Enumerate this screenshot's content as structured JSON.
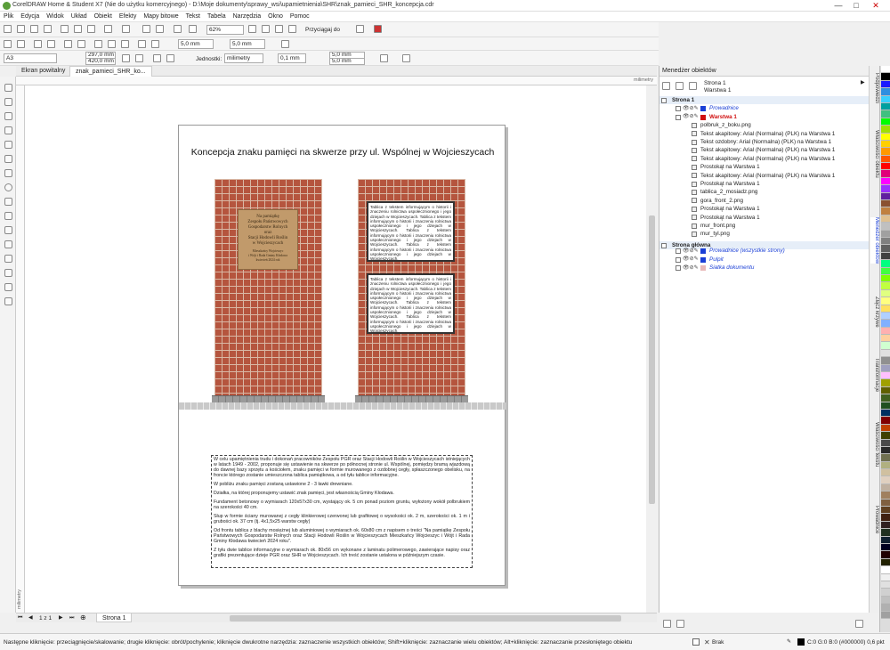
{
  "window": {
    "title": "CorelDRAW Home & Student X7 (Nie do użytku komercyjnego) - D:\\Moje dokumenty\\sprawy_wsi\\upamietnienia\\SHR\\znak_pamieci_SHR_koncepcja.cdr"
  },
  "menu": [
    "Plik",
    "Edycja",
    "Widok",
    "Układ",
    "Obiekt",
    "Efekty",
    "Mapy bitowe",
    "Tekst",
    "Tabela",
    "Narzędzia",
    "Okno",
    "Pomoc"
  ],
  "toolbar": {
    "zoom": "62%",
    "snap_label": "Przyciągaj do",
    "nudge_h": "5,0 mm",
    "nudge_v": "5,0 mm"
  },
  "property_bar": {
    "page_size": "A3",
    "width": "297,0 mm",
    "height": "420,0 mm",
    "units_label": "Jednostki:",
    "units": "milimetry",
    "nudge": "0,1 mm",
    "dup_x": "5,0 mm",
    "dup_y": "5,0 mm"
  },
  "tabs": {
    "welcome": "Ekran powitalny",
    "document": "znak_pamieci_SHR_ko..."
  },
  "rulers": {
    "h_unit": "milimetry",
    "v_unit": "milimetry"
  },
  "page_bar": {
    "counter": "1 z 1",
    "page_tab": "Strona 1"
  },
  "document": {
    "title": "Koncepcja znaku pamięci na skwerze przy ul. Wspólnej w Wojcieszycach",
    "plaque": [
      "Na pamiątkę",
      "Zespołu Państwowych",
      "Gospodarstw Rolnych",
      "oraz",
      "Stacji Hodowli Roślin",
      "w Wojcieszycach",
      "Mieszkańcy Wojcieszyc",
      "i Wójt i Rada Gminy Kłodawa",
      "kwiecień 2024 rok"
    ],
    "panel_text": "Tablica z tekstem informującym o historii i znaczeniu rolnictwa uspołecznionego i jego dziejach w Wojcieszycach. Tablica z tekstem informującym o historii i znaczeniu rolnictwa uspołecznionego i jego dziejach w Wojcieszycach. Tablica z tekstem informującym o historii i znaczeniu rolnictwa uspołecznionego i jego dziejach w Wojcieszycach. Tablica z tekstem informującym o historii i znaczeniu rolnictwa uspołecznionego i jego dziejach w Wojcieszycach.",
    "paragraphs": [
      "W celu upamiętnienia trudu i dokonań pracowników Zespołu PGR oraz Stacji Hodowli Roślin w Wojcieszycach istniejących w latach 1949 - 2002, proponuje się ustawienie na skwerze po północnej stronie ul. Wspólnej, pomiędzy bramą wjazdową do dawnej bazy sprzętu a kościołem, znaku pamięci w formie murowanego z ozdobnej cegły, spłaszczonego obelisku, na froncie którego zostanie umieszczona tablica pamiątkowa, a od tyłu tablice informacyjne.",
      "W pobliżu znaku pamięci zostaną ustawione 2 - 3 ławki drewniane.",
      "Działka, na której proponujemy ustawić znak pamięci, jest własnością Gminy Kłodawa.",
      "Fundament betonowy o wymiarach 120x57x30 cm, wystający ok. 5 cm ponad poziom gruntu, wyłożony wokół polbrukiem na szerokości 40 cm.",
      "Słup w formie ściany murowanej z cegły klinkierowej czerwonej lub grafitowej o wysokości ok. 2 m, szerokości ok. 1 m i grubości ok. 37 cm (tj. 4x1,5x25 warstw cegły)",
      "Od frontu tablica z blachy mosiężnej lub aluminiowej o wymiarach ok. 60x80 cm z napisem o treści \"Na pamiątkę Zespołu Państwowych Gospodarstw Rolnych oraz Stacji Hodowli Roślin w Wojcieszycach Mieszkańcy Wojcieszyc i Wójt i Rada Gminy Kłodawa kwiecień 2024 roku\".",
      "Z tyłu dwie tablice informacyjne o wymiarach ok. 80x56 cm wykonane z laminatu polimerowego, zawierające napisy oraz grafiki prezentujące dzieje PGR oraz SHR w Wojcieszycach. Ich treść zostanie ustalona w późniejszym czasie."
    ]
  },
  "object_manager": {
    "header": "Menedżer obiektów",
    "breadcrumb": [
      "Strona 1",
      "Warstwa 1"
    ],
    "rows": [
      {
        "text": "Strona 1",
        "level": 0,
        "bold": true,
        "type": "page"
      },
      {
        "text": "Prowadnice",
        "level": 1,
        "italic": true,
        "color": "#1a3fd6",
        "swatch": "#1a3fd6",
        "type": "layer"
      },
      {
        "text": "Warstwa 1",
        "level": 1,
        "bold": true,
        "color": "#d01010",
        "swatch": "#d01010",
        "type": "layer"
      },
      {
        "text": "polbruk_z_boku.png",
        "level": 2,
        "type": "bitmap"
      },
      {
        "text": "Tekst akapitowy: Arial (Normalna) (PLK) na Warstwa 1",
        "level": 2,
        "type": "text"
      },
      {
        "text": "Tekst ozdobny: Arial (Normalna) (PLK) na Warstwa 1",
        "level": 2,
        "type": "artistic"
      },
      {
        "text": "Tekst akapitowy: Arial (Normalna) (PLK) na Warstwa 1",
        "level": 2,
        "type": "text"
      },
      {
        "text": "Tekst akapitowy: Arial (Normalna) (PLK) na Warstwa 1",
        "level": 2,
        "type": "text"
      },
      {
        "text": "Prostokąt na Warstwa 1",
        "level": 2,
        "type": "rect"
      },
      {
        "text": "Tekst akapitowy: Arial (Normalna) (PLK) na Warstwa 1",
        "level": 2,
        "type": "text"
      },
      {
        "text": "Prostokąt na Warstwa 1",
        "level": 2,
        "type": "rect"
      },
      {
        "text": "tablica_2_mosiadz.png",
        "level": 2,
        "type": "bitmap"
      },
      {
        "text": "gora_front_2.png",
        "level": 2,
        "type": "bitmap"
      },
      {
        "text": "Prostokąt na Warstwa 1",
        "level": 2,
        "type": "rect"
      },
      {
        "text": "Prostokąt na Warstwa 1",
        "level": 2,
        "type": "rect"
      },
      {
        "text": "mur_front.png",
        "level": 2,
        "type": "bitmap"
      },
      {
        "text": "mur_tyl.png",
        "level": 2,
        "type": "bitmap"
      },
      {
        "text": "Strona główna",
        "level": 0,
        "bold": true,
        "type": "page"
      },
      {
        "text": "Prowadnice (wszystkie strony)",
        "level": 1,
        "italic": true,
        "color": "#1a3fd6",
        "swatch": "#1a3fd6",
        "type": "layer"
      },
      {
        "text": "Pulpit",
        "level": 1,
        "italic": true,
        "color": "#1a3fd6",
        "swatch": "#1a3fd6",
        "type": "layer"
      },
      {
        "text": "Siatka dokumentu",
        "level": 1,
        "italic": true,
        "color": "#1a3fd6",
        "swatch": "#e8b8b8",
        "type": "layer"
      }
    ]
  },
  "docker_tabs": [
    "Podpowiedzi",
    "Właściwości obiektu",
    "Menedżer obiektów",
    "Złącz krzywe",
    "Transformacje",
    "Właściwości tekstu",
    "Prowadnice"
  ],
  "status": {
    "hint": "Następne kliknięcie: przeciągnięcie/skalowanie; drugie kliknięcie: obrót/pochylenie; kliknięcie dwukrotne narzędzia: zaznaczenie wszystkich obiektów; Shift+kliknięcie: zaznaczanie wielu obiektów; Alt+kliknięcie: zaznaczanie przesłoniętego obiektu",
    "fill": "Brak",
    "color_info": "C:0 M:0 Y:0 K:100",
    "outline": "C:0 G:0 B:0 (#000000) 0,6 pkt"
  },
  "palette": [
    "#ffffff",
    "#000000",
    "#1a1aff",
    "#2f8fe0",
    "#3ad0ff",
    "#00a0a0",
    "#40c080",
    "#00ff00",
    "#a0e000",
    "#ffff00",
    "#ffd000",
    "#ff9900",
    "#ff5500",
    "#ff0000",
    "#e0007a",
    "#ff00ff",
    "#9a30ff",
    "#6020a0",
    "#8a5030",
    "#c08040",
    "#e0c090",
    "#c0c0c0",
    "#a0a0a0",
    "#808080",
    "#606060",
    "#404040",
    "#00ff80",
    "#40ff40",
    "#80ff00",
    "#c0ff40",
    "#e0ff80",
    "#ffff80",
    "#ffe060",
    "#b0d0ff",
    "#80b0ff",
    "#ffb0b0",
    "#ffd0a0",
    "#d0ffd0",
    "#e0e0e0",
    "#909090",
    "#a0a0c0",
    "#ffc0ff",
    "#a0a000",
    "#606000",
    "#406020",
    "#205020",
    "#003060",
    "#800000",
    "#c04000",
    "#404000",
    "#4a4a4a",
    "#2a2a2a",
    "#707050",
    "#b0b080",
    "#d0c0a0",
    "#e0d0c0",
    "#c0b0a0",
    "#a08060",
    "#806040",
    "#604020",
    "#402010",
    "#302020",
    "#203020",
    "#102030",
    "#000020",
    "#200000",
    "#202000",
    "#ffffff",
    "#f0f0f0",
    "#e0e0e0",
    "#d0d0d0",
    "#c0c0c0",
    "#b0b0b0",
    "#a0a0a0"
  ]
}
